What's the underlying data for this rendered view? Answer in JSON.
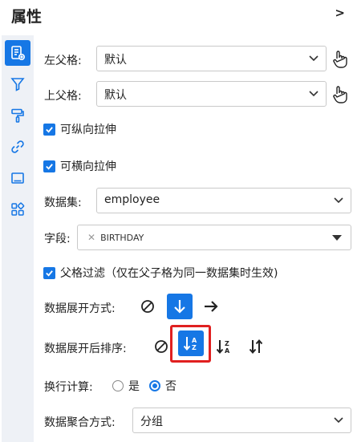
{
  "panel": {
    "title": "属性",
    "collapse_glyph": ">"
  },
  "sidebar": {
    "icons": [
      {
        "name": "cell-properties-icon",
        "active": true
      },
      {
        "name": "filter-icon",
        "active": false
      },
      {
        "name": "paint-roller-icon",
        "active": false
      },
      {
        "name": "link-icon",
        "active": false
      },
      {
        "name": "border-icon",
        "active": false
      },
      {
        "name": "widgets-icon",
        "active": false
      }
    ],
    "accent_color": "#1677e5"
  },
  "left_parent": {
    "label": "左父格:",
    "value": "默认"
  },
  "top_parent": {
    "label": "上父格:",
    "value": "默认"
  },
  "stretch": {
    "vertical_label": "可纵向拉伸",
    "vertical_checked": true,
    "horizontal_label": "可横向拉伸",
    "horizontal_checked": true
  },
  "dataset": {
    "label": "数据集:",
    "value": "employee"
  },
  "field": {
    "label": "字段:",
    "tag": "BIRTHDAY"
  },
  "parent_filter": {
    "label": "父格过滤（仅在父子格为同一数据集时生效)",
    "checked": true
  },
  "expand_mode": {
    "label": "数据展开方式:",
    "options": [
      "no-expand-icon",
      "expand-down-icon",
      "expand-right-icon"
    ],
    "selected": "expand-down-icon"
  },
  "sort_after_expand": {
    "label": "数据展开后排序:",
    "options": [
      "no-sort-icon",
      "sort-ascending-icon",
      "sort-descending-icon",
      "custom-sort-icon"
    ],
    "selected": "sort-ascending-icon"
  },
  "wrap_calc": {
    "label": "换行计算:",
    "yes_label": "是",
    "no_label": "否",
    "selected": "否"
  },
  "aggregation": {
    "label": "数据聚合方式:",
    "value": "分组"
  }
}
